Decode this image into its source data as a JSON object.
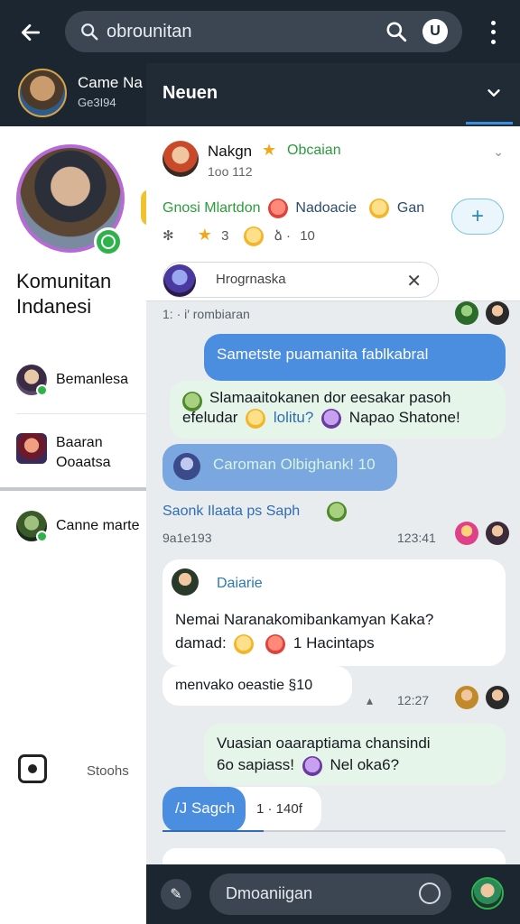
{
  "top_bar": {
    "search_text": "obrounitan",
    "u_badge": "U"
  },
  "sub_header": {
    "game_title": "Came Na",
    "game_subtitle": "Ge3I94",
    "panel_title": "Neuen"
  },
  "left_panel": {
    "community_name_line1": "Komunitan",
    "community_name_line2": "Indanesi",
    "items": [
      {
        "label": "Bemanlesa"
      },
      {
        "label_line1": "Baaran",
        "label_line2": "Ooaatsa"
      },
      {
        "label": "Canne marte"
      }
    ],
    "bottom_label": "Stoohs"
  },
  "notification_card": {
    "name": "Nakgn",
    "group": "Obcaian",
    "sub": "1oo 112",
    "row2_green": "Gnosi Mlartdon",
    "row2_blue": "Nadoacie",
    "row2_tail": "Gan",
    "row3_count1": "3",
    "row3_mid": "ձ ·",
    "row3_count2": "10",
    "input_text": "Hrogrnaska"
  },
  "chat": {
    "time1": "1: · i′ rombiaran",
    "msg1": "Sametste puamanita fablkabral",
    "msg2_line1": "Slamaaitokanen dor eesakar pasoh",
    "msg2_line2": "efeludar",
    "msg2_mid": "lolitu?",
    "msg2_tail": "Napao Shatone!",
    "msg3": "Caroman Olbighank! 10",
    "link1": "Saonk Ilaata ps Saph",
    "time2_left": "9a1e193",
    "time2_right": "123:41",
    "sender": "Daiarie",
    "msg4_line1": "Nemai Naranakomibankamyan Kaka?",
    "msg4_line2": "damad:",
    "msg4_tail": "1 Hacintaps",
    "msg5": "menvako oeastie §10",
    "time3": "12:27",
    "msg6_line1": "Vuasian oaaraptiama chansindi",
    "msg6_line2": "6o sapiass!",
    "msg6_tail": "Nel oka6?",
    "reply_label": "/J Sagch",
    "reply_time": "1 · 140f"
  },
  "bottom_bar": {
    "input_text": "Dmoaniigan"
  }
}
